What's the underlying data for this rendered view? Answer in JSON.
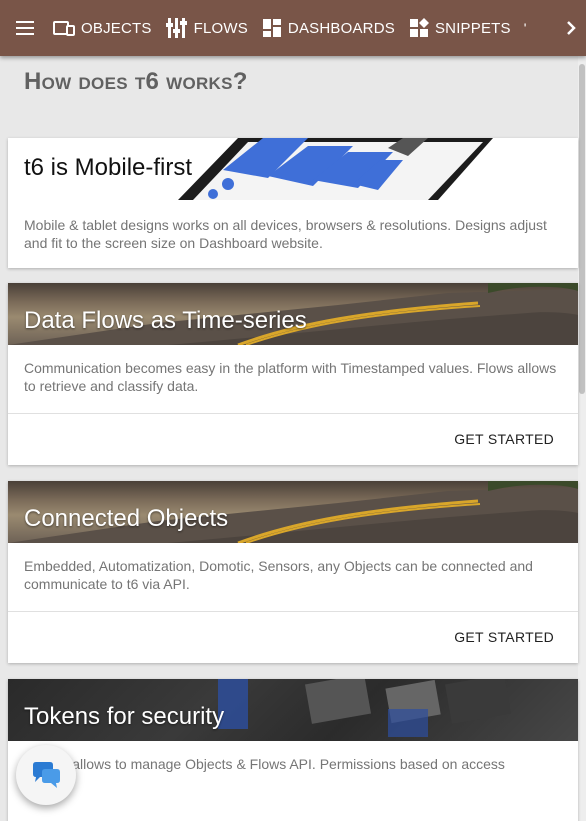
{
  "topbar": {
    "nav": [
      {
        "label": "OBJECTS",
        "icon": "objects-icon"
      },
      {
        "label": "FLOWS",
        "icon": "flows-icon"
      },
      {
        "label": "DASHBOARDS",
        "icon": "dashboards-icon"
      },
      {
        "label": "SNIPPETS",
        "icon": "snippets-icon"
      }
    ],
    "overflow": "'"
  },
  "page": {
    "title": "How does t6 works?"
  },
  "cards": [
    {
      "title": "t6 is Mobile-first",
      "text": "Mobile & tablet designs works on all devices, browsers & resolutions. Designs adjust and fit to the screen size on Dashboard website."
    },
    {
      "title": "Data Flows as Time-series",
      "text": "Communication becomes easy in the platform with Timestamped values. Flows allows to retrieve and classify data.",
      "action": "GET STARTED"
    },
    {
      "title": "Connected Objects",
      "text": "Embedded, Automatization, Domotic, Sensors, any Objects can be connected and communicate to t6 via API.",
      "action": "GET STARTED"
    },
    {
      "title": "Tokens for security",
      "text": "Tokens allows to manage Objects & Flows API. Permissions based on access"
    }
  ],
  "colors": {
    "topbar": "#795548",
    "title": "#616161",
    "text": "#757575"
  }
}
